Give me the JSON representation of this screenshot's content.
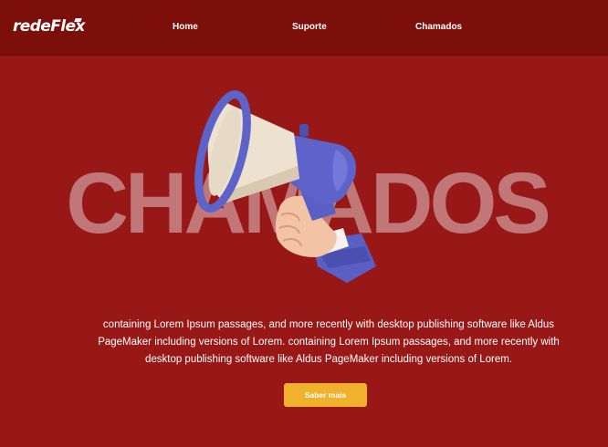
{
  "brand": {
    "logo_text": "redeFlex"
  },
  "nav": {
    "home": "Home",
    "suporte": "Suporte",
    "chamados": "Chamados"
  },
  "hero": {
    "word": "CHAMADOS",
    "illustration": "megaphone-icon"
  },
  "content": {
    "description": "containing Lorem Ipsum passages, and more recently with desktop publishing software like Aldus PageMaker including versions of Lorem.  containing Lorem Ipsum passages, and more recently with desktop publishing software like Aldus PageMaker including versions of Lorem.",
    "cta_label": "Saber mais"
  },
  "colors": {
    "background": "#981817",
    "navbar": "#7d0f0b",
    "accent": "#f0b22d",
    "megaphone": "#5e63c9"
  }
}
